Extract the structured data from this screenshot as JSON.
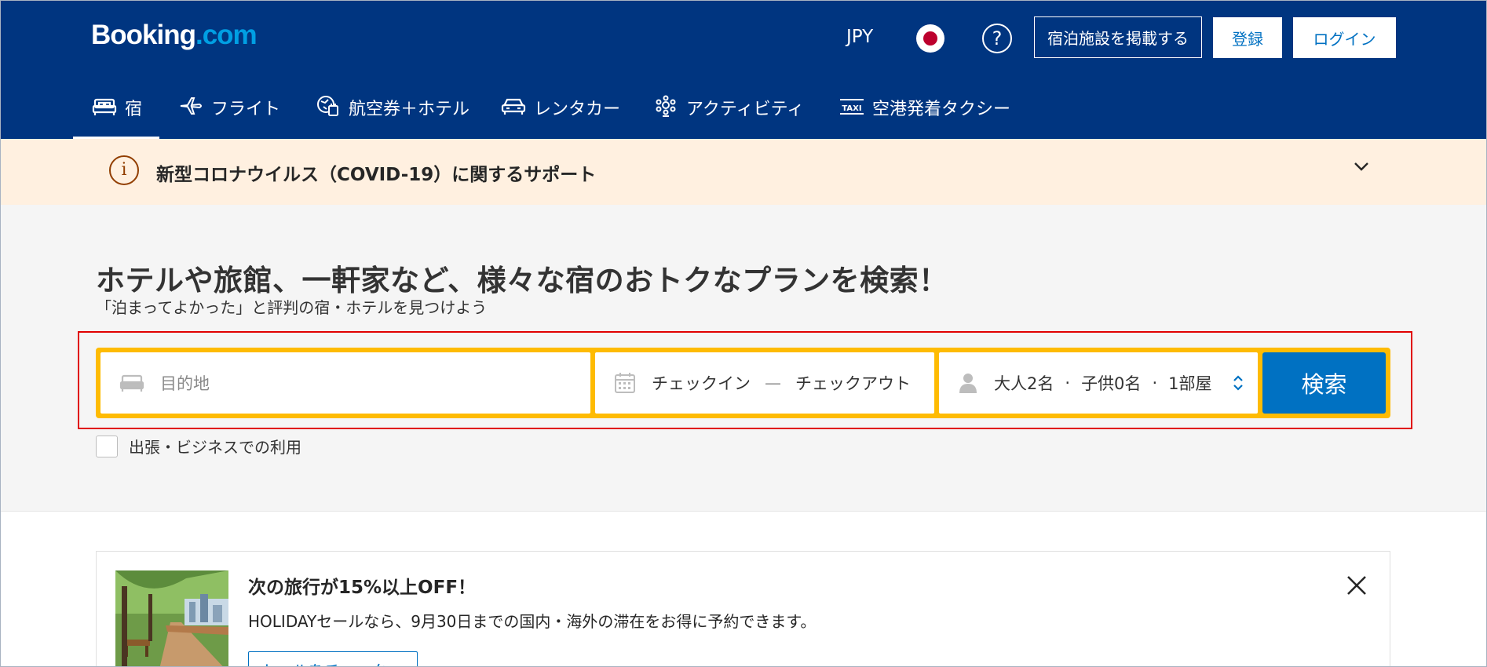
{
  "header": {
    "logo": {
      "main": "Booking",
      "suffix": ".com"
    },
    "currency": "JPY",
    "flag_icon": "japan-flag-icon",
    "help_icon": "question-icon",
    "list_property_label": "宿泊施設を掲載する",
    "register_label": "登録",
    "login_label": "ログイン"
  },
  "nav": {
    "items": [
      {
        "label": "宿",
        "icon": "bed-icon",
        "active": true
      },
      {
        "label": "フライト",
        "icon": "plane-icon"
      },
      {
        "label": "航空券＋ホテル",
        "icon": "plane-hotel-icon"
      },
      {
        "label": "レンタカー",
        "icon": "car-icon"
      },
      {
        "label": "アクティビティ",
        "icon": "attractions-icon"
      },
      {
        "label": "空港発着タクシー",
        "icon": "taxi-icon"
      }
    ]
  },
  "covid_banner": {
    "icon": "info-icon",
    "text": "新型コロナウイルス（COVID-19）に関するサポート",
    "chevron": "chevron-down-icon"
  },
  "hero": {
    "title": "ホテルや旅館、一軒家など、様々な宿のおトクなプランを検索！",
    "subtitle": "「泊まってよかった」と評判の宿・ホテルを見つけよう"
  },
  "search": {
    "destination_placeholder": "目的地",
    "checkin_label": "チェックイン",
    "date_separator": "—",
    "checkout_label": "チェックアウト",
    "adults": "大人2名",
    "children": "子供0名",
    "rooms": "1部屋",
    "guest_separator": "·",
    "search_button": "検索",
    "business_travel_label": "出張・ビジネスでの利用",
    "colors": {
      "box": "#febb02",
      "button": "#0071c2"
    }
  },
  "promo": {
    "title": "次の旅行が15%以上OFF！",
    "text": "HOLIDAYセールなら、9月30日までの国内・海外の滞在をお得に予約できます。",
    "button_label": "セールをチェック",
    "close_icon": "close-icon"
  },
  "colors": {
    "header_bg": "#003580",
    "banner_bg": "#fff0e0",
    "hero_bg": "#f5f5f5"
  }
}
